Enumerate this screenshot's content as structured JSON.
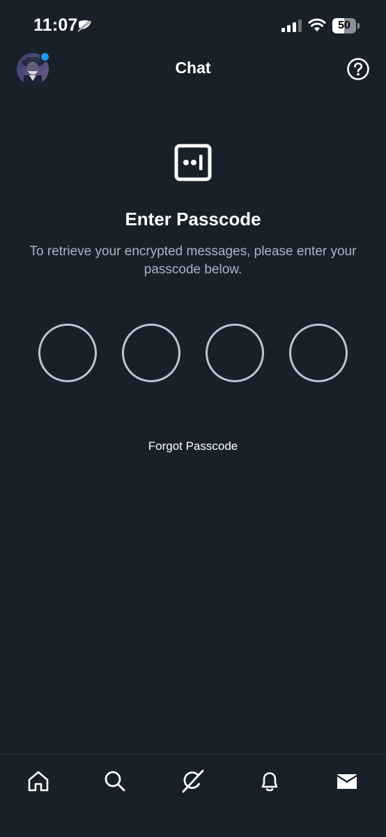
{
  "status_bar": {
    "time": "11:07",
    "battery_percent": 50,
    "battery_label": "50",
    "icons": [
      "focus-mode-icon",
      "cellular-signal-icon",
      "wifi-icon",
      "battery-icon"
    ]
  },
  "header": {
    "title": "Chat",
    "avatar": "avatar",
    "help_icon": "help-icon"
  },
  "main": {
    "icon": "encrypted-chat-icon",
    "title": "Enter Passcode",
    "description": "To retrieve your encrypted messages, please enter your passcode below.",
    "passcode_length": 4,
    "passcode_digits_entered": 0,
    "forgot_label": "Forgot Passcode"
  },
  "bottom_nav": {
    "items": [
      "home-icon",
      "search-icon",
      "grok-icon",
      "notifications-icon",
      "messages-icon"
    ],
    "active": "messages-icon"
  },
  "colors": {
    "background": "#18202a",
    "text": "#ffffff",
    "muted_text": "#a8b4c0",
    "circle_border": "#b9c6d3",
    "accent": "#1d9bf0",
    "divider": "#2f3a46"
  }
}
